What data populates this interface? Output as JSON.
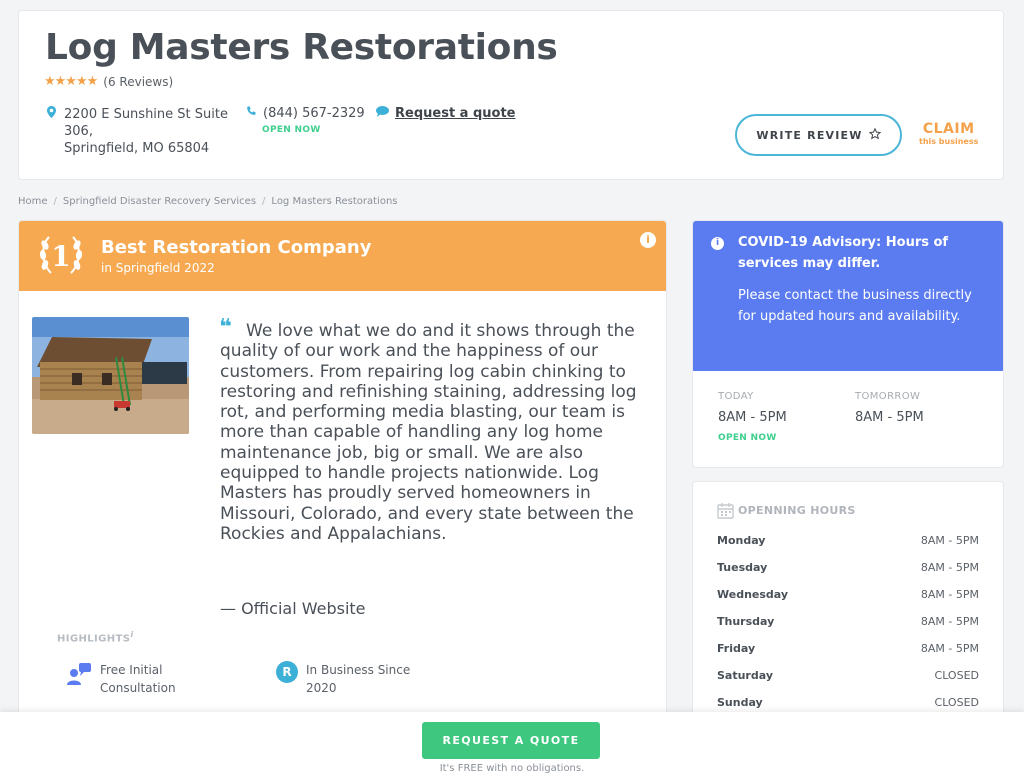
{
  "business": {
    "name": "Log Masters Restorations",
    "stars": "★★★★★",
    "reviews_label": "(6 Reviews)",
    "address_line1": "2200 E Sunshine St Suite",
    "address_line2": "306,",
    "address_line3": "Springfield, MO 65804",
    "phone": "(844) 567-2329",
    "open_status": "OPEN NOW",
    "request_quote_link": "Request a quote",
    "write_review": "WRITE REVIEW",
    "claim_big": "CLAIM",
    "claim_small": "this business"
  },
  "breadcrumb": {
    "home": "Home",
    "category": "Springfield Disaster Recovery Services",
    "current": "Log Masters Restorations"
  },
  "award": {
    "rank": "1",
    "title": "Best Restoration Company",
    "subtitle": "in Springfield 2022"
  },
  "quote": {
    "text": "We love what we do and it shows through the quality of our work and the happiness of our customers. From repairing log cabin chinking to restoring and refinishing staining, addressing log rot, and performing media blasting, our team is more than capable of handling any log home maintenance job, big or small. We are also equipped to handle projects nationwide. Log Masters has proudly served homeowners in Missouri, Colorado, and every state between the Rockies and Appalachians.",
    "attribution": "— Official Website"
  },
  "highlights": {
    "title": "HIGHLIGHTS",
    "items": [
      {
        "line1": "Free Initial",
        "line2": "Consultation",
        "icon": "consultation-icon"
      },
      {
        "line1": "In Business Since",
        "line2": "2020",
        "icon": "r-badge-icon",
        "badge": "R"
      }
    ]
  },
  "covid": {
    "title": "COVID-19 Advisory: Hours of services may differ.",
    "body": "Please contact the business directly for updated hours and availability.",
    "today_label": "TODAY",
    "today_hours": "8AM - 5PM",
    "today_status": "OPEN NOW",
    "tomorrow_label": "TOMORROW",
    "tomorrow_hours": "8AM - 5PM"
  },
  "hours": {
    "title": "OPENNING HOURS",
    "days": [
      {
        "day": "Monday",
        "time": "8AM - 5PM"
      },
      {
        "day": "Tuesday",
        "time": "8AM - 5PM"
      },
      {
        "day": "Wednesday",
        "time": "8AM - 5PM"
      },
      {
        "day": "Thursday",
        "time": "8AM - 5PM"
      },
      {
        "day": "Friday",
        "time": "8AM - 5PM"
      },
      {
        "day": "Saturday",
        "time": "CLOSED"
      },
      {
        "day": "Sunday",
        "time": "CLOSED"
      }
    ]
  },
  "cta": {
    "button": "REQUEST A QUOTE",
    "sub": "It's FREE with no obligations."
  },
  "colors": {
    "award_orange": "#f6a951",
    "covid_blue": "#5b7cf0",
    "cta_green": "#3ec87f",
    "accent_teal": "#3db0d8"
  }
}
